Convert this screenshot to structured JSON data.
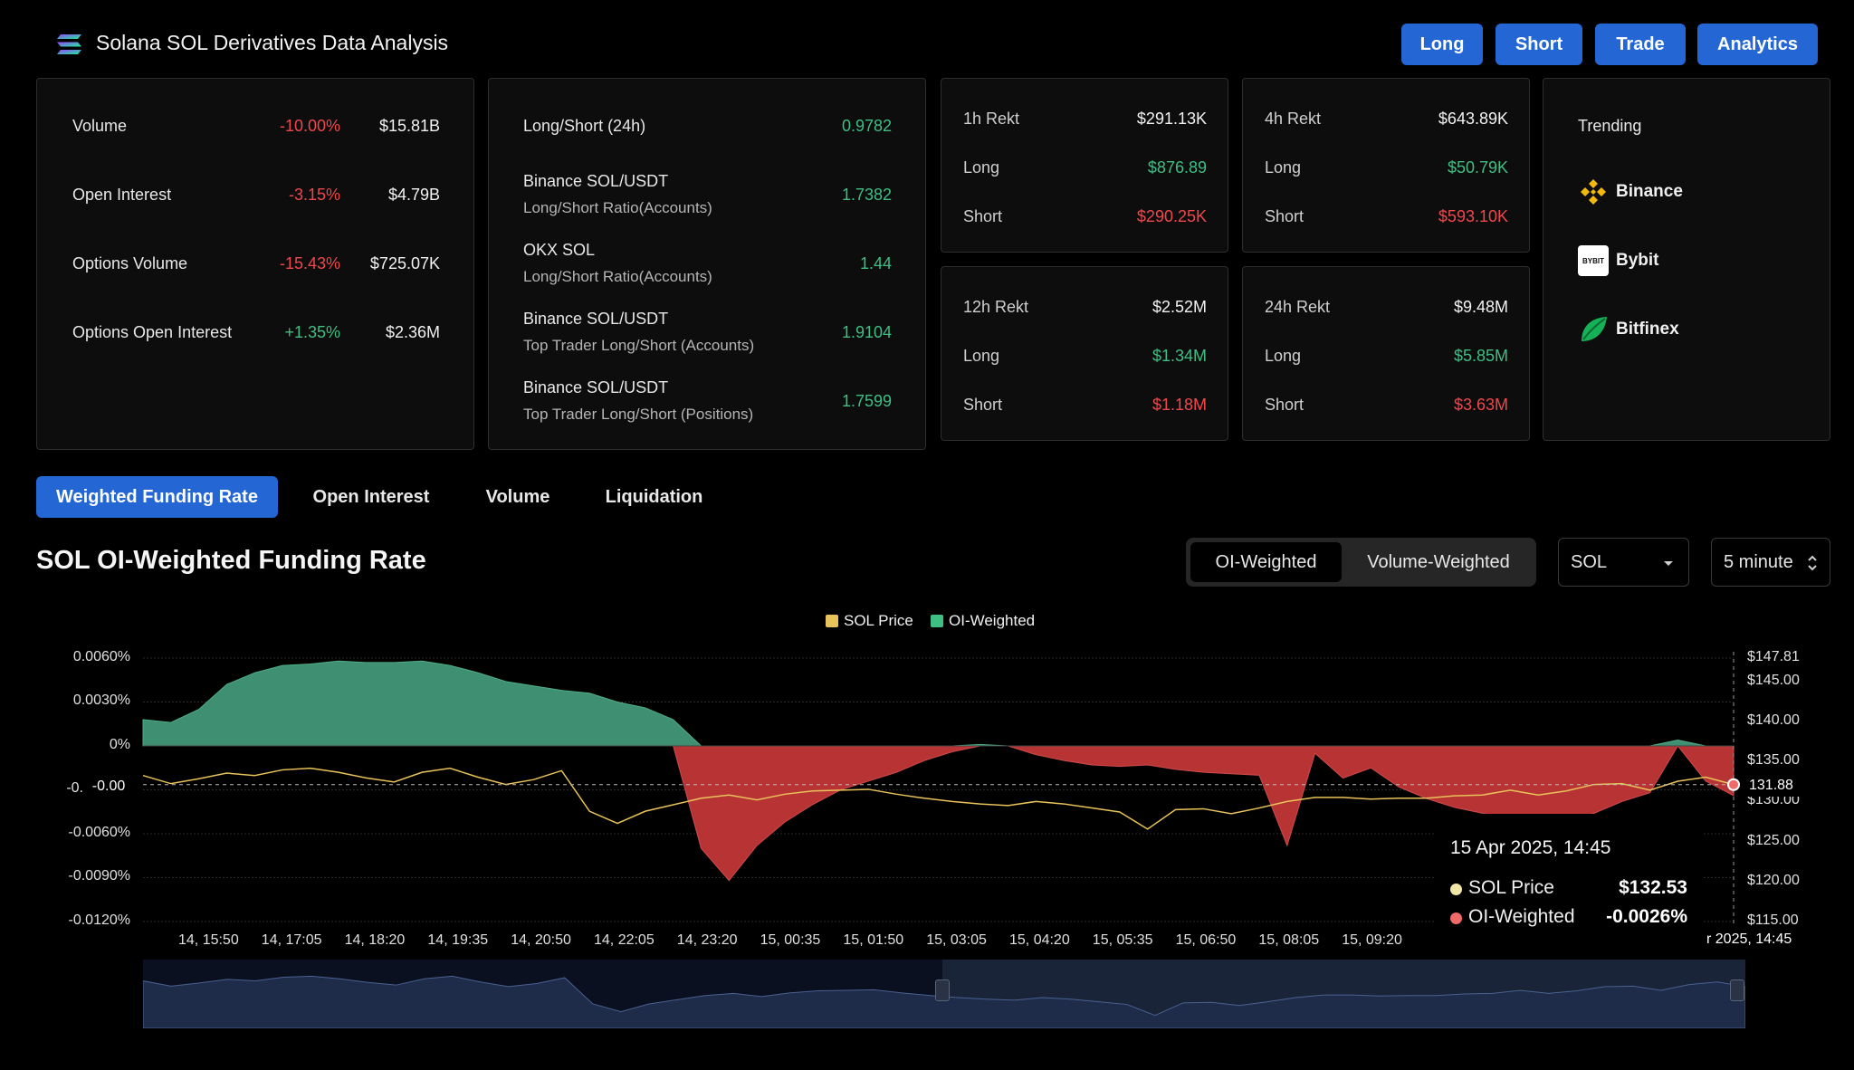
{
  "header": {
    "title": "Solana SOL Derivatives Data Analysis",
    "buttons": [
      "Long",
      "Short",
      "Trade",
      "Analytics"
    ]
  },
  "overview": [
    {
      "label": "Volume",
      "change": "-10.00%",
      "value": "$15.81B",
      "trend": "down"
    },
    {
      "label": "Open Interest",
      "change": "-3.15%",
      "value": "$4.79B",
      "trend": "down"
    },
    {
      "label": "Options Volume",
      "change": "-15.43%",
      "value": "$725.07K",
      "trend": "down"
    },
    {
      "label": "Options Open Interest",
      "change": "+1.35%",
      "value": "$2.36M",
      "trend": "up"
    }
  ],
  "long_short": [
    {
      "label": "Long/Short (24h)",
      "sub": "",
      "value": "0.9782"
    },
    {
      "label": "Binance SOL/USDT",
      "sub": "Long/Short Ratio(Accounts)",
      "value": "1.7382"
    },
    {
      "label": "OKX SOL",
      "sub": "Long/Short Ratio(Accounts)",
      "value": "1.44"
    },
    {
      "label": "Binance SOL/USDT",
      "sub": "Top Trader Long/Short (Accounts)",
      "value": "1.9104"
    },
    {
      "label": "Binance SOL/USDT",
      "sub": "Top Trader Long/Short (Positions)",
      "value": "1.7599"
    }
  ],
  "rekt": [
    {
      "title": "1h Rekt",
      "total": "$291.13K",
      "long_label": "Long",
      "long": "$876.89",
      "short_label": "Short",
      "short": "$290.25K"
    },
    {
      "title": "4h Rekt",
      "total": "$643.89K",
      "long_label": "Long",
      "long": "$50.79K",
      "short_label": "Short",
      "short": "$593.10K"
    },
    {
      "title": "12h Rekt",
      "total": "$2.52M",
      "long_label": "Long",
      "long": "$1.34M",
      "short_label": "Short",
      "short": "$1.18M"
    },
    {
      "title": "24h Rekt",
      "total": "$9.48M",
      "long_label": "Long",
      "long": "$5.85M",
      "short_label": "Short",
      "short": "$3.63M"
    }
  ],
  "trending": {
    "title": "Trending",
    "items": [
      {
        "name": "Binance",
        "icon": "binance-icon",
        "color": "#f0b90b"
      },
      {
        "name": "Bybit",
        "icon": "bybit-icon",
        "badge": "BYBIT"
      },
      {
        "name": "Bitfinex",
        "icon": "bitfinex-icon",
        "color": "#16b157"
      }
    ]
  },
  "tabs": [
    "Weighted Funding Rate",
    "Open Interest",
    "Volume",
    "Liquidation"
  ],
  "section": {
    "title": "SOL OI-Weighted Funding Rate",
    "seg": [
      "OI-Weighted",
      "Volume-Weighted"
    ],
    "coin": "SOL",
    "interval": "5 minute"
  },
  "chart_data": {
    "type": "area",
    "series": [
      {
        "name": "SOL Price",
        "color": "#e8c25a"
      },
      {
        "name": "OI-Weighted",
        "color": "#3f8f72",
        "negative_color": "#b83434"
      }
    ],
    "left_axis": [
      "0.0060%",
      "0.0030%",
      "0%",
      "-0.",
      "-0.0060%",
      "-0.0090%",
      "-0.0120%"
    ],
    "left_axis_current": "-0.00",
    "right_axis": [
      "$147.81",
      "$145.00",
      "$140.00",
      "$135.00",
      "$130.00",
      "$125.00",
      "$120.00",
      "$115.00"
    ],
    "right_axis_current": "131.88",
    "x": [
      "14, 15:50",
      "14, 17:05",
      "14, 18:20",
      "14, 19:35",
      "14, 20:50",
      "14, 22:05",
      "14, 23:20",
      "15, 00:35",
      "15, 01:50",
      "15, 03:05",
      "15, 04:20",
      "15, 05:35",
      "15, 06:50",
      "15, 08:05",
      "15, 09:20"
    ],
    "x_end_label": "r 2025, 14:45",
    "ylim_left": [
      -0.012,
      0.006
    ],
    "ylim_right": [
      115,
      147.81
    ],
    "oi_weighted": [
      0.0018,
      0.0016,
      0.0025,
      0.0042,
      0.005,
      0.0055,
      0.0056,
      0.0058,
      0.0057,
      0.0057,
      0.0058,
      0.0055,
      0.005,
      0.0044,
      0.0041,
      0.0038,
      0.0036,
      0.003,
      0.0026,
      0.0018,
      -0.007,
      -0.0092,
      -0.0068,
      -0.0052,
      -0.004,
      -0.003,
      -0.0024,
      -0.0018,
      -0.001,
      -0.0004,
      0.0001,
      0.0,
      -0.0006,
      -0.001,
      -0.0013,
      -0.0014,
      -0.0013,
      -0.0016,
      -0.0018,
      -0.0019,
      -0.002,
      -0.0068,
      -0.0005,
      -0.0022,
      -0.0015,
      -0.0028,
      -0.0036,
      -0.0042,
      -0.0046,
      -0.005,
      -0.0053,
      -0.0052,
      -0.0046,
      -0.0038,
      -0.0032,
      0.0004,
      -0.0024,
      -0.0034
    ],
    "sol_price": [
      133.0,
      132.0,
      132.6,
      133.3,
      133.0,
      133.7,
      133.9,
      133.4,
      132.7,
      132.2,
      133.4,
      133.9,
      132.8,
      131.9,
      132.5,
      133.6,
      128.6,
      127.1,
      128.6,
      129.4,
      130.2,
      130.6,
      130.0,
      130.7,
      131.1,
      131.2,
      131.3,
      130.7,
      130.2,
      129.8,
      129.5,
      129.3,
      129.8,
      129.5,
      129.0,
      128.5,
      126.4,
      128.8,
      128.9,
      128.3,
      129.0,
      129.8,
      130.3,
      130.3,
      130.1,
      130.2,
      130.2,
      130.5,
      130.6,
      131.2,
      130.6,
      131.1,
      131.9,
      132.0,
      131.2,
      132.3,
      132.8,
      131.88
    ],
    "tooltip": {
      "date": "15 Apr 2025, 14:45",
      "rows": [
        {
          "name": "SOL Price",
          "value": "$132.53",
          "color": "#f0e6a8"
        },
        {
          "name": "OI-Weighted",
          "value": "-0.0026%",
          "color": "#f06a6a"
        }
      ]
    }
  }
}
